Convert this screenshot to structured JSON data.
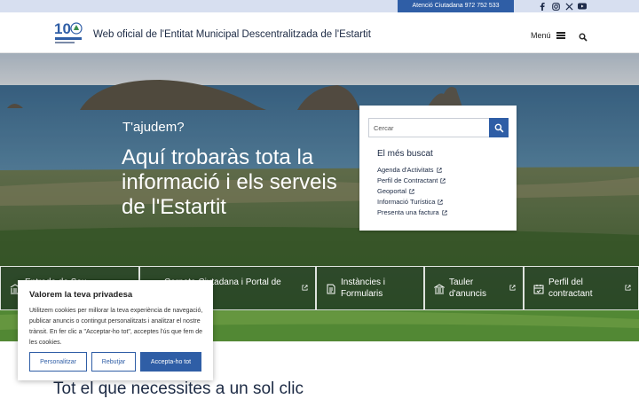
{
  "topbar": {
    "contact_label": "Atenció Ciutadana 972 752 533",
    "social": [
      "facebook-icon",
      "instagram-icon",
      "x-icon",
      "youtube-icon"
    ]
  },
  "header": {
    "logo_text": "10",
    "title": "Web oficial de l'Entitat Municipal Descentralitzada de l'Estartit",
    "menu_label": "Menú"
  },
  "hero": {
    "kicker": "T'ajudem?",
    "headline": "Aquí trobaràs tota la informació i els serveis de l'Estartit"
  },
  "search_card": {
    "placeholder": "Cercar",
    "most_searched_title": "El més buscat",
    "links": [
      "Agenda d'Activitats",
      "Perfil de Contractant",
      "Geoportal",
      "Informació Turística",
      "Presenta una factura"
    ]
  },
  "tiles": [
    "Entrada de Seu",
    "Carpeta Ciutadana i Portal de",
    "Instàncies i Formularis",
    "Tauler d'anuncis",
    "Perfil del contractant"
  ],
  "section_title": "Tot el que necessites a un sol clic",
  "cookie": {
    "title": "Valorem la teva privadesa",
    "body": "Utilitzem cookies per millorar la teva experiència de navegació, publicar anuncis o contingut personalitzats i analitzar el nostre trànsit. En fer clic a \"Acceptar-ho tot\", acceptes l'ús que fem de les cookies.",
    "customize": "Personalitzar",
    "reject": "Rebutjar",
    "accept": "Accepta-ho tot"
  },
  "colors": {
    "accent": "#2f5ea6",
    "topbar": "#d7dff0",
    "text_dark": "#1c2a44"
  }
}
